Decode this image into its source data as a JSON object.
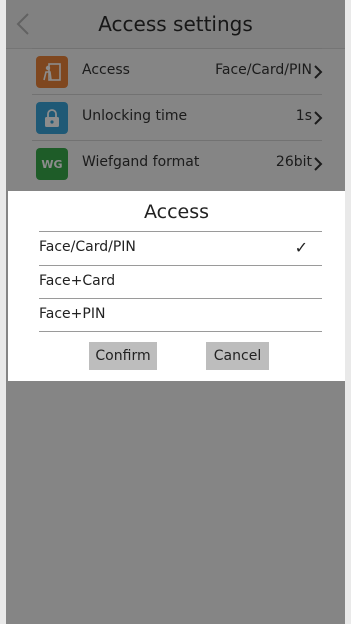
{
  "header": {
    "title": "Access settings"
  },
  "settings": [
    {
      "label": "Access",
      "value": "Face/Card/PIN",
      "icon": "access-person-icon",
      "icon_color": "#e8823a"
    },
    {
      "label": "Unlocking time",
      "value": "1s",
      "icon": "lock-icon",
      "icon_color": "#3aa3d8"
    },
    {
      "label": "Wiefgand format",
      "value": "26bit",
      "icon": "wiegand-icon",
      "icon_color": "#37a84a",
      "icon_text": "WG"
    }
  ],
  "dialog": {
    "title": "Access",
    "options": [
      {
        "label": "Face/Card/PIN",
        "selected": true
      },
      {
        "label": "Face+Card",
        "selected": false
      },
      {
        "label": "Face+PIN",
        "selected": false
      }
    ],
    "check_mark": "✓",
    "confirm_label": "Confirm",
    "cancel_label": "Cancel"
  }
}
